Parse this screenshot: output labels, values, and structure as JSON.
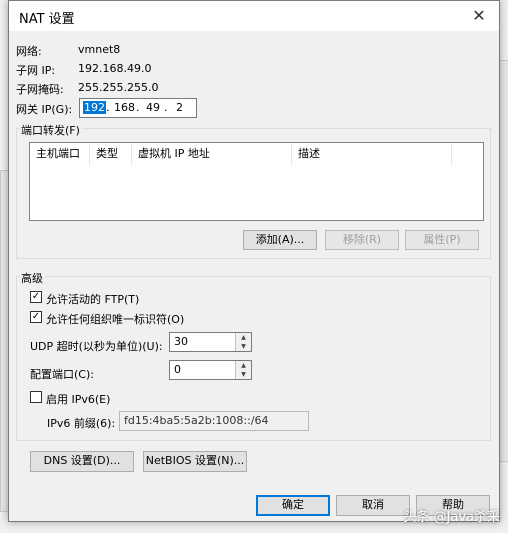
{
  "title": "NAT 设置",
  "network": {
    "label": "网络:",
    "value": "vmnet8"
  },
  "subnet_ip": {
    "label": "子网 IP:",
    "value": "192.168.49.0"
  },
  "subnet_mask": {
    "label": "子网掩码:",
    "value": "255.255.255.0"
  },
  "gateway": {
    "label": "网关 IP(G):",
    "octets": [
      "192",
      "168",
      "49",
      "2"
    ]
  },
  "port_forwarding": {
    "group_label": "端口转发(F)",
    "columns": [
      "主机端口",
      "类型",
      "虚拟机 IP 地址",
      "描述"
    ],
    "add_button": "添加(A)...",
    "remove_button": "移除(R)",
    "properties_button": "属性(P)"
  },
  "advanced": {
    "group_label": "高级",
    "allow_ftp": "允许活动的 FTP(T)",
    "allow_any_oui": "允许任何组织唯一标识符(O)",
    "udp_timeout_label": "UDP 超时(以秒为单位)(U):",
    "udp_timeout_value": "30",
    "config_port_label": "配置端口(C):",
    "config_port_value": "0",
    "enable_ipv6": "启用 IPv6(E)",
    "ipv6_prefix_label": "IPv6 前缀(6):",
    "ipv6_prefix_value": "fd15:4ba5:5a2b:1008::/64"
  },
  "dns_button": "DNS 设置(D)...",
  "netbios_button": "NetBIOS 设置(N)...",
  "ok_button": "确定",
  "cancel_button": "取消",
  "help_button": "帮助",
  "watermark": "头条 @Java杀采"
}
